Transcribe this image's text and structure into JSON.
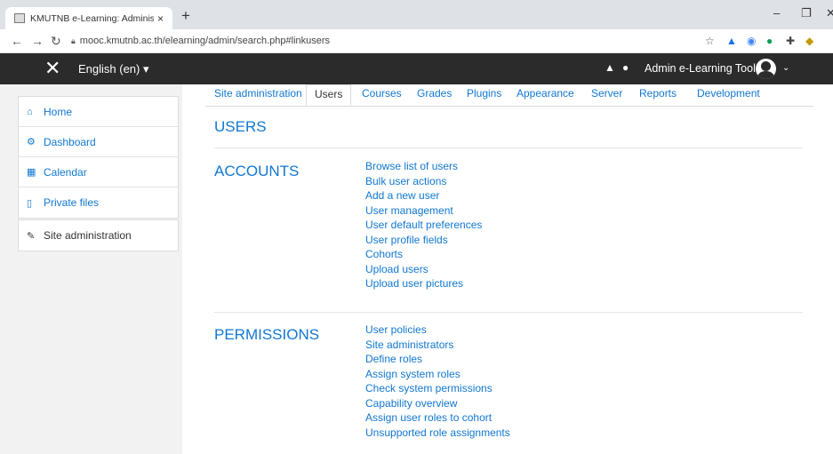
{
  "browser": {
    "tab_title": "KMUTNB e-Learning: Administra",
    "tab_close": "×",
    "new_tab": "+",
    "url": "mooc.kmutnb.ac.th/elearning/admin/search.php#linkusers",
    "minimize": "–",
    "restore": "❐",
    "close": "✕"
  },
  "navbar": {
    "menu_close": "✕",
    "language": "English (en) ▾",
    "user_name": "Admin e-Learning Tools",
    "user_caret": "⌄"
  },
  "drawer": {
    "items": [
      {
        "label": "Home",
        "icon": "home-icon"
      },
      {
        "label": "Dashboard",
        "icon": "dashboard-icon"
      },
      {
        "label": "Calendar",
        "icon": "calendar-icon"
      },
      {
        "label": "Private files",
        "icon": "file-icon"
      }
    ],
    "admin_item": {
      "label": "Site administration",
      "icon": "wrench-icon"
    }
  },
  "tabs": [
    {
      "label": "Site administration"
    },
    {
      "label": "Users",
      "active": true
    },
    {
      "label": "Courses"
    },
    {
      "label": "Grades"
    },
    {
      "label": "Plugins"
    },
    {
      "label": "Appearance"
    },
    {
      "label": "Server"
    },
    {
      "label": "Reports"
    },
    {
      "label": "Development"
    }
  ],
  "main": {
    "heading": "USERS",
    "sections": [
      {
        "title": "ACCOUNTS",
        "links": [
          "Browse list of users",
          "Bulk user actions",
          "Add a new user",
          "User management",
          "User default preferences",
          "User profile fields",
          "Cohorts",
          "Upload users",
          "Upload user pictures"
        ]
      },
      {
        "title": "PERMISSIONS",
        "links": [
          "User policies",
          "Site administrators",
          "Define roles",
          "Assign system roles",
          "Check system permissions",
          "Capability overview",
          "Assign user roles to cohort",
          "Unsupported role assignments"
        ]
      }
    ]
  },
  "colors": {
    "link": "#1177d1",
    "navbar": "#2b2b2b",
    "drawer_bg": "#f2f2f2"
  }
}
